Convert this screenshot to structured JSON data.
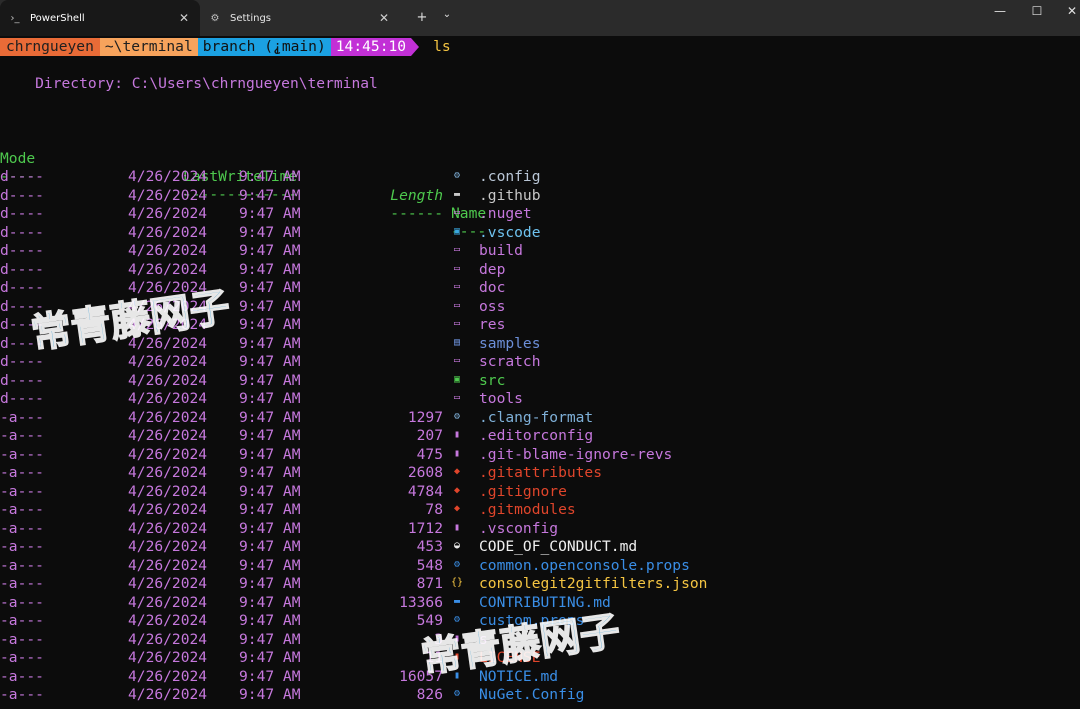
{
  "tabs": [
    {
      "label": "PowerShell",
      "icon": "powershell-icon",
      "icon_glyph": "›_",
      "close": "✕"
    },
    {
      "label": "Settings",
      "icon": "gear-icon",
      "icon_glyph": "⚙",
      "close": "✕"
    }
  ],
  "tabbar": {
    "new_tab": "+",
    "dropdown": "⌄"
  },
  "window": {
    "minimize": "—",
    "maximize": "☐",
    "close": "✕"
  },
  "prompt": {
    "user": "chrngueyen",
    "path": "~\\terminal",
    "branch": "branch (⸘main)",
    "time": "14:45:10",
    "command": "ls"
  },
  "directory_line": "    Directory: C:\\Users\\chrngueyen\\terminal",
  "headers": {
    "mode": "Mode",
    "lastwrite": "LastWriteTime",
    "length": "Length",
    "name": "Name"
  },
  "underlines": {
    "mode": "----",
    "lastwrite": "-------------",
    "length": "------",
    "name": "----"
  },
  "rows": [
    {
      "mode": "d----",
      "date": "4/26/2024",
      "time": "9:47 AM",
      "length": "",
      "icon": "gear-icon",
      "glyph": "⚙",
      "icon_color": "#7fb0d8",
      "name": ".config",
      "name_color": "#b9c6d6"
    },
    {
      "mode": "d----",
      "date": "4/26/2024",
      "time": "9:47 AM",
      "length": "",
      "icon": "folder-github-icon",
      "glyph": "▬",
      "icon_color": "#c8c8c8",
      "name": ".github",
      "name_color": "#c8c8c8"
    },
    {
      "mode": "d----",
      "date": "4/26/2024",
      "time": "9:47 AM",
      "length": "",
      "icon": "folder-icon",
      "glyph": "▭",
      "icon_color": "#c678dd",
      "name": ".nuget",
      "name_color": "#c678dd"
    },
    {
      "mode": "d----",
      "date": "4/26/2024",
      "time": "9:47 AM",
      "length": "",
      "icon": "vscode-folder-icon",
      "glyph": "▣",
      "icon_color": "#3aa8e0",
      "name": ".vscode",
      "name_color": "#6fc3f0"
    },
    {
      "mode": "d----",
      "date": "4/26/2024",
      "time": "9:47 AM",
      "length": "",
      "icon": "folder-icon",
      "glyph": "▭",
      "icon_color": "#c678dd",
      "name": "build",
      "name_color": "#c678dd"
    },
    {
      "mode": "d----",
      "date": "4/26/2024",
      "time": "9:47 AM",
      "length": "",
      "icon": "folder-icon",
      "glyph": "▭",
      "icon_color": "#c678dd",
      "name": "dep",
      "name_color": "#c678dd"
    },
    {
      "mode": "d----",
      "date": "4/26/2024",
      "time": "9:47 AM",
      "length": "",
      "icon": "folder-icon",
      "glyph": "▭",
      "icon_color": "#c678dd",
      "name": "doc",
      "name_color": "#c678dd"
    },
    {
      "mode": "d----",
      "date": "4/26/2024",
      "time": "9:47 AM",
      "length": "",
      "icon": "folder-icon",
      "glyph": "▭",
      "icon_color": "#c678dd",
      "name": "oss",
      "name_color": "#c678dd"
    },
    {
      "mode": "d----",
      "date": "4/26/2024",
      "time": "9:47 AM",
      "length": "",
      "icon": "folder-icon",
      "glyph": "▭",
      "icon_color": "#c678dd",
      "name": "res",
      "name_color": "#c678dd"
    },
    {
      "mode": "d----",
      "date": "4/26/2024",
      "time": "9:47 AM",
      "length": "",
      "icon": "samples-folder-icon",
      "glyph": "▤",
      "icon_color": "#6c8fd8",
      "name": "samples",
      "name_color": "#6c8fd8"
    },
    {
      "mode": "d----",
      "date": "4/26/2024",
      "time": "9:47 AM",
      "length": "",
      "icon": "folder-icon",
      "glyph": "▭",
      "icon_color": "#c678dd",
      "name": "scratch",
      "name_color": "#c678dd"
    },
    {
      "mode": "d----",
      "date": "4/26/2024",
      "time": "9:47 AM",
      "length": "",
      "icon": "src-folder-icon",
      "glyph": "▣",
      "icon_color": "#4ec94e",
      "name": "src",
      "name_color": "#4ec94e"
    },
    {
      "mode": "d----",
      "date": "4/26/2024",
      "time": "9:47 AM",
      "length": "",
      "icon": "folder-icon",
      "glyph": "▭",
      "icon_color": "#c678dd",
      "name": "tools",
      "name_color": "#c678dd"
    },
    {
      "mode": "-a---",
      "date": "4/26/2024",
      "time": "9:47 AM",
      "length": "1297",
      "icon": "gear-icon",
      "glyph": "⚙",
      "icon_color": "#7fb0d8",
      "name": ".clang-format",
      "name_color": "#7fb0d8"
    },
    {
      "mode": "-a---",
      "date": "4/26/2024",
      "time": "9:47 AM",
      "length": "207",
      "icon": "file-icon",
      "glyph": "▮",
      "icon_color": "#c678dd",
      "name": ".editorconfig",
      "name_color": "#c678dd"
    },
    {
      "mode": "-a---",
      "date": "4/26/2024",
      "time": "9:47 AM",
      "length": "475",
      "icon": "file-icon",
      "glyph": "▮",
      "icon_color": "#c678dd",
      "name": ".git-blame-ignore-revs",
      "name_color": "#c678dd"
    },
    {
      "mode": "-a---",
      "date": "4/26/2024",
      "time": "9:47 AM",
      "length": "2608",
      "icon": "git-icon",
      "glyph": "◆",
      "icon_color": "#e0452b",
      "name": ".gitattributes",
      "name_color": "#e0452b"
    },
    {
      "mode": "-a---",
      "date": "4/26/2024",
      "time": "9:47 AM",
      "length": "4784",
      "icon": "git-icon",
      "glyph": "◆",
      "icon_color": "#e0452b",
      "name": ".gitignore",
      "name_color": "#e0452b"
    },
    {
      "mode": "-a---",
      "date": "4/26/2024",
      "time": "9:47 AM",
      "length": "78",
      "icon": "git-icon",
      "glyph": "◆",
      "icon_color": "#e0452b",
      "name": ".gitmodules",
      "name_color": "#e0452b"
    },
    {
      "mode": "-a---",
      "date": "4/26/2024",
      "time": "9:47 AM",
      "length": "1712",
      "icon": "file-icon",
      "glyph": "▮",
      "icon_color": "#c678dd",
      "name": ".vsconfig",
      "name_color": "#c678dd"
    },
    {
      "mode": "-a---",
      "date": "4/26/2024",
      "time": "9:47 AM",
      "length": "453",
      "icon": "markdown-icon",
      "glyph": "◒",
      "icon_color": "#e8e8e8",
      "name": "CODE_OF_CONDUCT.md",
      "name_color": "#f0f0f0"
    },
    {
      "mode": "-a---",
      "date": "4/26/2024",
      "time": "9:47 AM",
      "length": "548",
      "icon": "gear-icon",
      "glyph": "⚙",
      "icon_color": "#3a8ee6",
      "name": "common.openconsole.props",
      "name_color": "#3a8ee6"
    },
    {
      "mode": "-a---",
      "date": "4/26/2024",
      "time": "9:47 AM",
      "length": "871",
      "icon": "json-icon",
      "glyph": "{}",
      "icon_color": "#f5c542",
      "name": "consolegit2gitfilters.json",
      "name_color": "#f5c542"
    },
    {
      "mode": "-a---",
      "date": "4/26/2024",
      "time": "9:47 AM",
      "length": "13366",
      "icon": "contributing-icon",
      "glyph": "▬",
      "icon_color": "#3a8ee6",
      "name": "CONTRIBUTING.md",
      "name_color": "#3a8ee6"
    },
    {
      "mode": "-a---",
      "date": "4/26/2024",
      "time": "9:47 AM",
      "length": "549",
      "icon": "gear-icon",
      "glyph": "⚙",
      "icon_color": "#3a8ee6",
      "name": "custom.props",
      "name_color": "#3a8ee6"
    },
    {
      "mode": "-a---",
      "date": "4/26/2024",
      "time": "9:47 AM",
      "length": "3",
      "icon": "file-icon",
      "glyph": "▮",
      "icon_color": "#c678dd",
      "name": "s",
      "name_color": "#c678dd"
    },
    {
      "mode": "-a---",
      "date": "4/26/2024",
      "time": "9:47 AM",
      "length": "11",
      "icon": "license-icon",
      "glyph": "▮",
      "icon_color": "#e0452b",
      "name": "LICENSE",
      "name_color": "#e0452b"
    },
    {
      "mode": "-a---",
      "date": "4/26/2024",
      "time": "9:47 AM",
      "length": "16057",
      "icon": "notice-icon",
      "glyph": "▮",
      "icon_color": "#3a8ee6",
      "name": "NOTICE.md",
      "name_color": "#3a8ee6"
    },
    {
      "mode": "-a---",
      "date": "4/26/2024",
      "time": "9:47 AM",
      "length": "826",
      "icon": "gear-icon",
      "glyph": "⚙",
      "icon_color": "#3a8ee6",
      "name": "NuGet.Config",
      "name_color": "#3a8ee6"
    }
  ],
  "watermarks": [
    "常青藤网子",
    "常青藤网子"
  ]
}
